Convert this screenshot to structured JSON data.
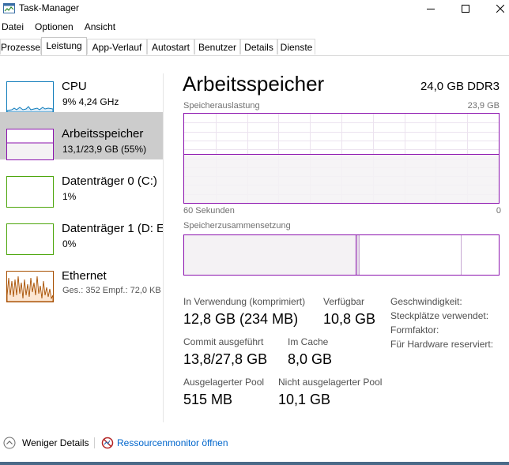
{
  "window": {
    "title": "Task-Manager",
    "icon": "task-manager-icon"
  },
  "menu": [
    "Datei",
    "Optionen",
    "Ansicht"
  ],
  "tabs": [
    "Prozesse",
    "Leistung",
    "App-Verlauf",
    "Autostart",
    "Benutzer",
    "Details",
    "Dienste"
  ],
  "active_tab": "Leistung",
  "resources": [
    {
      "name": "CPU",
      "sub": "9% 4,24 GHz",
      "color": "#117dbb"
    },
    {
      "name": "Arbeitsspeicher",
      "sub": "13,1/23,9 GB (55%)",
      "color": "#8b12ae",
      "selected": true
    },
    {
      "name": "Datenträger 0 (C:)",
      "sub": "1%",
      "color": "#4da60c"
    },
    {
      "name": "Datenträger 1 (D: E",
      "sub": "0%",
      "color": "#4da60c"
    },
    {
      "name": "Ethernet",
      "sub": "Ges.: 352 Empf.: 72,0 KB",
      "color": "#a74f01"
    }
  ],
  "detail": {
    "title": "Arbeitsspeicher",
    "spec": "24,0 GB DDR3",
    "usage_label": "Speicherauslastung",
    "usage_max": "23,9 GB",
    "usage_fraction": 0.55,
    "time_left": "60 Sekunden",
    "time_right": "0",
    "composition_label": "Speicherzusammensetzung",
    "stats": {
      "in_use_label": "In Verwendung (komprimiert)",
      "in_use_value": "12,8 GB (234 MB)",
      "available_label": "Verfügbar",
      "available_value": "10,8 GB",
      "commit_label": "Commit ausgeführt",
      "commit_value": "13,8/27,8 GB",
      "cache_label": "Im Cache",
      "cache_value": "8,0 GB",
      "paged_label": "Ausgelagerter Pool",
      "paged_value": "515 MB",
      "nonpaged_label": "Nicht ausgelagerter Pool",
      "nonpaged_value": "10,1 GB"
    },
    "props": {
      "speed_label": "Geschwindigkeit:",
      "slots_label": "Steckplätze verwendet:",
      "form_label": "Formfaktor:",
      "reserved_label": "Für Hardware reserviert:"
    }
  },
  "footer": {
    "less_details": "Weniger Details",
    "resource_monitor": "Ressourcenmonitor öffnen"
  },
  "colors": {
    "memory": "#8b12ae",
    "memory_fill": "#f4f2f4",
    "link": "#0066cc"
  }
}
